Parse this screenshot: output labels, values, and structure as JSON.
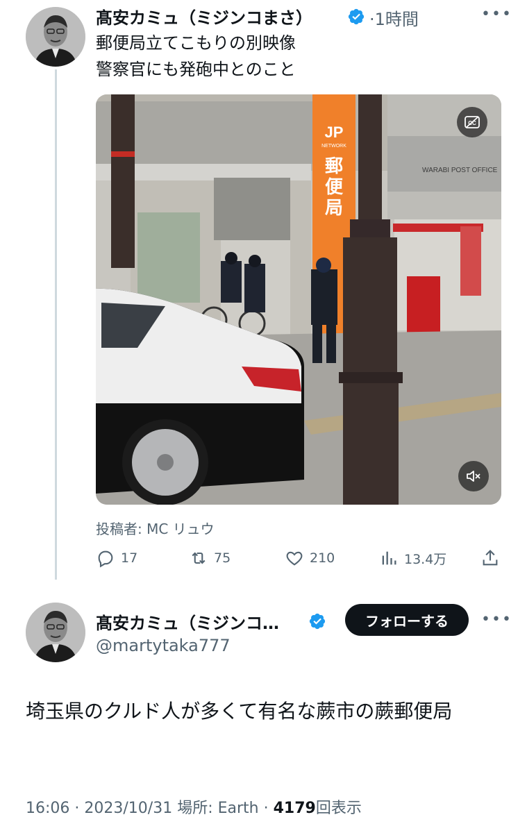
{
  "parent_tweet": {
    "author_name": "髙安カミュ（ミジンコまさ）",
    "separator": "·",
    "time_ago": "1時間",
    "text_line1": "郵便局立てこもりの別映像",
    "text_line2": "警察官にも発砲中とのこと",
    "media": {
      "sign_brand": "JP",
      "sign_brand_sub": "NETWORK",
      "sign_text": [
        "郵",
        "便",
        "局"
      ],
      "building_sign": "WARABI POST OFFICE",
      "cc_icon": "closed-captions-icon",
      "mute_icon": "speaker-muted-icon"
    },
    "credit_label": "投稿者: MC リュウ",
    "actions": {
      "replies": "17",
      "retweets": "75",
      "likes": "210",
      "views": "13.4万"
    }
  },
  "main_tweet": {
    "author_name": "髙安カミュ（ミジンコ…",
    "handle": "@martytaka777",
    "follow_label": "フォローする",
    "text": "埼玉県のクルド人が多くて有名な蕨市の蕨郵便局",
    "time": "16:06",
    "dot1": "·",
    "date": "2023/10/31",
    "location_label": "場所: Earth",
    "dot2": "·",
    "views_count": "4179",
    "views_label": "回表示"
  },
  "colors": {
    "verified_blue": "#1d9bf0",
    "text_primary": "#0f1419",
    "text_secondary": "#536471",
    "post_orange": "#f0802a"
  }
}
